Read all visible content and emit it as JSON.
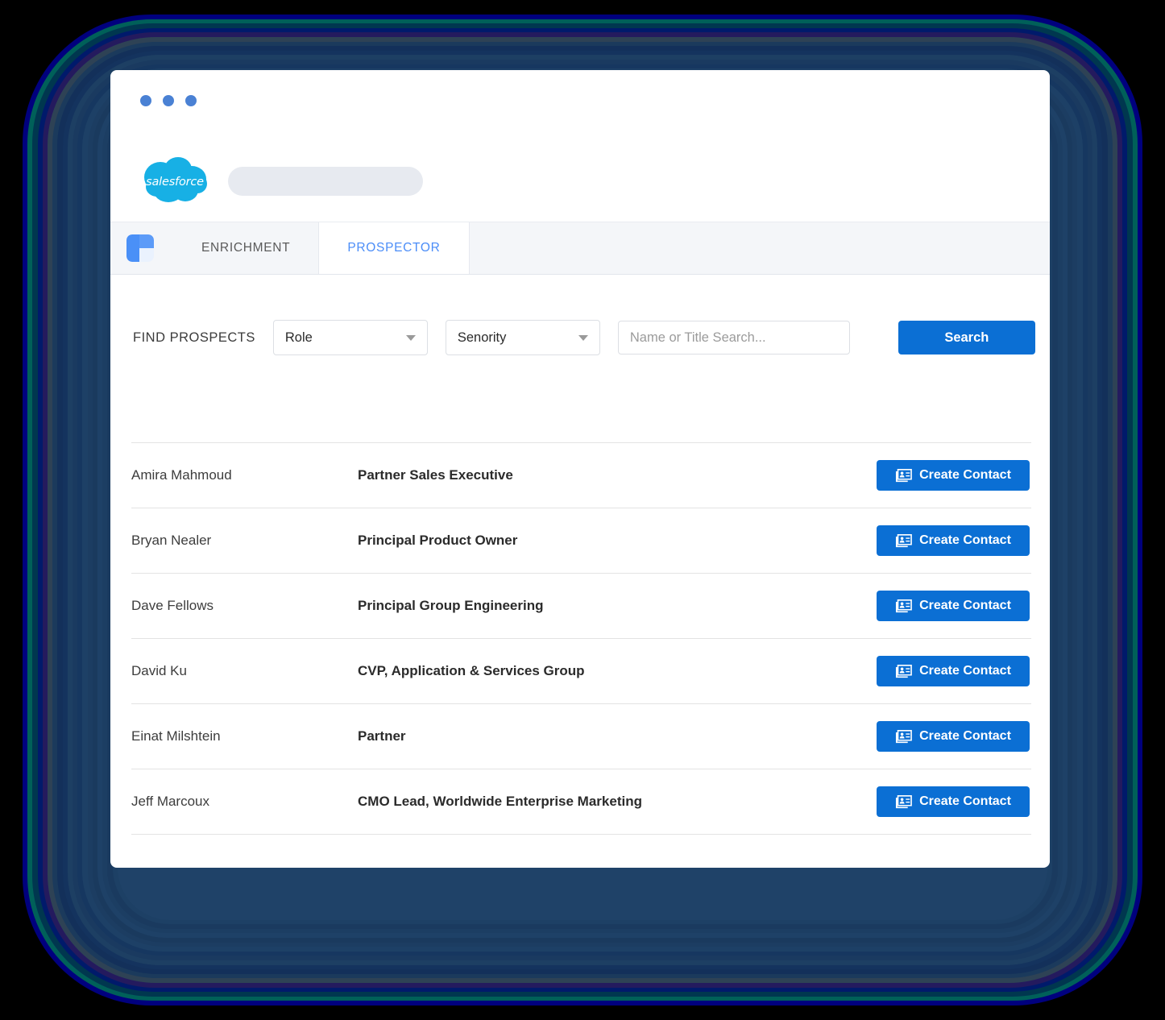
{
  "window": {
    "dots_count": 3,
    "dot_color": "#4a81d4"
  },
  "brand": {
    "logo_text": "salesforce",
    "logo_color": "#17b0e5",
    "omnibar_placeholder": ""
  },
  "tabs": {
    "app_icon": "prospector-app-icon",
    "items": [
      {
        "label": "ENRICHMENT",
        "active": false
      },
      {
        "label": "PROSPECTOR",
        "active": true
      }
    ],
    "active_color": "#4b8df8",
    "inactive_color": "#5a5a5a"
  },
  "search": {
    "find_label": "FIND PROSPECTS",
    "role_select": {
      "value": "Role",
      "icon": "chevron-down-icon"
    },
    "seniority_select": {
      "value": "Senority",
      "icon": "chevron-down-icon"
    },
    "name_input": {
      "value": "",
      "placeholder": "Name or Title Search..."
    },
    "search_button": "Search",
    "accent_color": "#0b6fd4"
  },
  "results": {
    "action_label": "Create Contact",
    "action_icon": "contact-card-icon",
    "rows": [
      {
        "name": "Amira Mahmoud",
        "title": "Partner Sales Executive"
      },
      {
        "name": "Bryan Nealer",
        "title": "Principal Product Owner"
      },
      {
        "name": "Dave Fellows",
        "title": "Principal Group Engineering"
      },
      {
        "name": "David Ku",
        "title": "CVP, Application & Services Group"
      },
      {
        "name": "Einat Milshtein",
        "title": "Partner"
      },
      {
        "name": "Jeff Marcoux",
        "title": "CMO Lead, Worldwide Enterprise Marketing"
      }
    ]
  },
  "backdrop": {
    "ring_colors": [
      "#00007e",
      "#006059",
      "#00374f",
      "#001a6b",
      "#241a5e",
      "#2e4255",
      "#1b3a5c",
      "#13305a",
      "#14335e",
      "#1d3f63",
      "#1a3a60",
      "#163760",
      "#1d4066",
      "#1c3d62",
      "#1a3a5e",
      "#1e4167",
      "#1c3e63",
      "#1a3a5f",
      "#1d4065",
      "#1f4268"
    ]
  }
}
